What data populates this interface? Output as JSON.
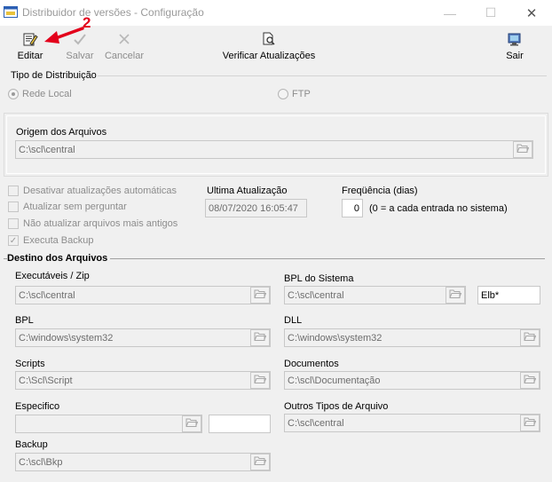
{
  "window": {
    "title": "Distribuidor de versões - Configuração",
    "min_glyph": "—",
    "max_glyph": "☐",
    "close_glyph": "✕"
  },
  "toolbar": {
    "editar": "Editar",
    "salvar": "Salvar",
    "cancelar": "Cancelar",
    "verificar": "Verificar Atualizações",
    "sair": "Sair"
  },
  "annotation": {
    "step": "2",
    "color": "#e3001b"
  },
  "distribution": {
    "label": "Tipo de Distribuição",
    "options": [
      "Rede Local",
      "FTP"
    ],
    "selected": "Rede Local"
  },
  "origin": {
    "label": "Origem dos Arquivos",
    "value": "C:\\scl\\central"
  },
  "options": {
    "disable_auto": "Desativar atualizações automáticas",
    "no_ask": "Atualizar sem perguntar",
    "no_older": "Não atualizar arquivos mais antigos",
    "backup": "Executa Backup",
    "backup_checked": true
  },
  "last_update": {
    "label": "Ultima Atualização",
    "value": "08/07/2020 16:05:47"
  },
  "frequency": {
    "label": "Freqüência (dias)",
    "value": "0",
    "hint": "(0 = a cada entrada no sistema)"
  },
  "destino": {
    "title": "Destino dos Arquivos",
    "executaveis": {
      "label": "Executáveis / Zip",
      "value": "C:\\scl\\central"
    },
    "bpl_sistema": {
      "label": "BPL do Sistema",
      "value": "C:\\scl\\central",
      "mask": "Elb*"
    },
    "bpl": {
      "label": "BPL",
      "value": "C:\\windows\\system32"
    },
    "dll": {
      "label": "DLL",
      "value": "C:\\windows\\system32"
    },
    "scripts": {
      "label": "Scripts",
      "value": "C:\\Scl\\Script"
    },
    "documentos": {
      "label": "Documentos",
      "value": "C:\\scl\\Documentação"
    },
    "especifico": {
      "label": "Especifico",
      "value": "",
      "mask": ""
    },
    "outros": {
      "label": "Outros Tipos de Arquivo",
      "value": "C:\\scl\\central"
    },
    "backup": {
      "label": "Backup",
      "value": "C:\\scl\\Bkp"
    }
  }
}
